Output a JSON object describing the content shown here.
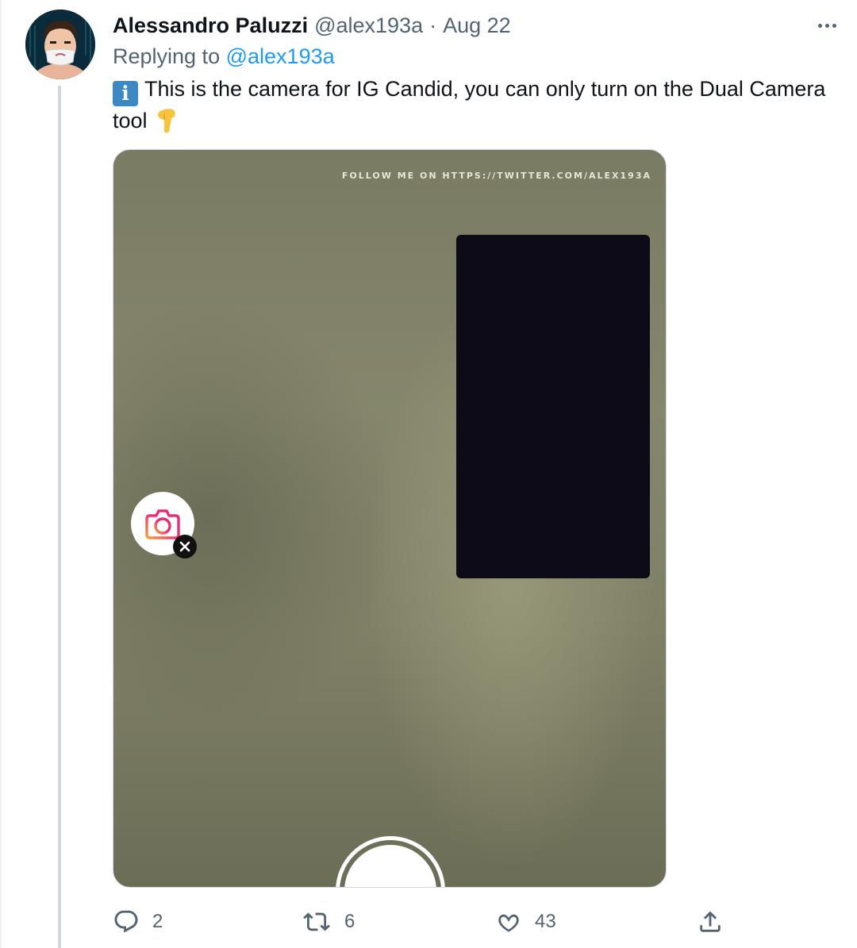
{
  "tweet": {
    "author_name": "Alessandro Paluzzi",
    "handle": "@alex193a",
    "separator": "·",
    "date": "Aug 22",
    "reply_prefix": "Replying to",
    "reply_mention": "@alex193a",
    "text": "This is the camera for IG Candid, you can only turn on the Dual Camera tool"
  },
  "media": {
    "watermark": "FOLLOW ME ON HTTPS://TWITTER.COM/ALEX193A",
    "icons": {
      "camera": "camera-add-icon",
      "close": "close-icon",
      "shutter": "shutter-button"
    }
  },
  "actions": {
    "reply_count": "2",
    "retweet_count": "6",
    "like_count": "43"
  },
  "colors": {
    "link": "#1d9bf0",
    "muted": "#536471",
    "thread_line": "#cfd9de",
    "camera_bg": "#7f8066",
    "preview_dark": "#0c0b17"
  }
}
